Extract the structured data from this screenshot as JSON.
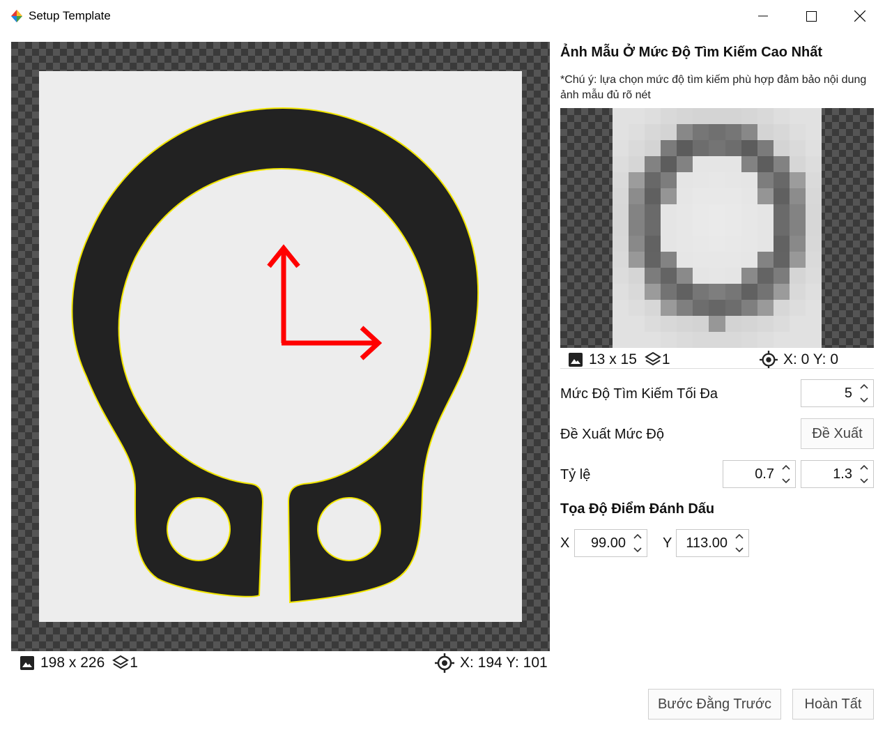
{
  "window": {
    "title": "Setup Template"
  },
  "main_image": {
    "size_text": "198 x 226",
    "layer_count": "1",
    "coords_text": "X: 194 Y: 101"
  },
  "template_panel": {
    "title": "Ảnh Mẫu Ở Mức Độ Tìm Kiếm Cao Nhất",
    "note": "*Chú ý: lựa chọn mức độ tìm kiếm phù hợp đảm bảo nội dung ảnh mẫu đủ rõ nét",
    "size_text": "13 x 15",
    "layer_count": "1",
    "coords_text": "X: 0 Y: 0"
  },
  "settings": {
    "max_level_label": "Mức Độ Tìm Kiếm Tối Đa",
    "max_level_value": "5",
    "suggest_label": "Đề Xuất Mức Độ",
    "suggest_button": "Đề Xuất",
    "scale_label": "Tỷ lệ",
    "scale_min": "0.7",
    "scale_max": "1.3"
  },
  "marker": {
    "title": "Tọa Độ Điểm Đánh Dấu",
    "x_label": "X",
    "x_value": "99.00",
    "y_label": "Y",
    "y_value": "113.00"
  },
  "footer": {
    "back_button": "Bước Đằng Trước",
    "finish_button": "Hoàn Tất"
  },
  "colors": {
    "contour": "#f2e600",
    "arrow": "#ff0000",
    "part": "#202020"
  }
}
